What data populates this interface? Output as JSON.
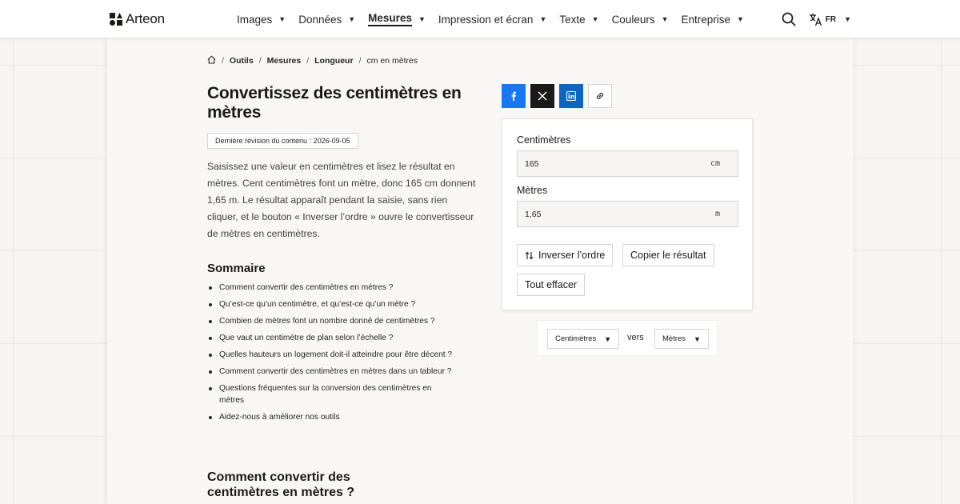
{
  "brand": {
    "name": "Arteon"
  },
  "nav": {
    "items": [
      {
        "label": "Images"
      },
      {
        "label": "Données"
      },
      {
        "label": "Mesures"
      },
      {
        "label": "Impression et écran"
      },
      {
        "label": "Texte"
      },
      {
        "label": "Couleurs"
      },
      {
        "label": "Entreprise"
      }
    ],
    "active_index": 2,
    "caret": "▼",
    "language": "FR"
  },
  "breadcrumb": {
    "separator": "/",
    "items": [
      "Outils",
      "Mesures",
      "Longueur"
    ],
    "current": "cm en mètres"
  },
  "page": {
    "title": "Convertissez des centimètres en mètres",
    "revision": "Dernière révision du contenu : 2026-09-05",
    "intro": "Saisissez une valeur en centimètres et lisez le résultat en mètres. Cent centimètres font un mètre, donc 165 cm donnent 1,65 m. Le résultat apparaît pendant la saisie, sans rien cliquer, et le bouton « Inverser l’ordre » ouvre le convertisseur de mètres en centimètres."
  },
  "toc": {
    "title": "Sommaire",
    "items": [
      "Comment convertir des centimètres en mètres ?",
      "Qu’est-ce qu’un centimètre, et qu’est-ce qu’un mètre ?",
      "Combien de mètres font un nombre donné de centimètres ?",
      "Que vaut un centimètre de plan selon l’échelle ?",
      "Quelles hauteurs un logement doit-il atteindre pour être décent ?",
      "Comment convertir des centimètres en mètres dans un tableur ?",
      "Questions fréquentes sur la conversion des centimètres en mètres",
      "Aidez-nous à améliorer nos outils"
    ]
  },
  "section": {
    "title": "Comment convertir des centimètres en mètres ?"
  },
  "share": {
    "icons": [
      "facebook-icon",
      "x-icon",
      "linkedin-icon",
      "link-icon"
    ],
    "colors": {
      "facebook": "#1877f2",
      "x": "#1c1917",
      "linkedin": "#0a66c2"
    }
  },
  "converter": {
    "input": {
      "label": "Centimètres",
      "value": "165",
      "unit": "cm"
    },
    "output": {
      "label": "Mètres",
      "value": "1,65",
      "unit": "m"
    },
    "swap_label": "Inverser l’ordre",
    "copy_label": "Copier le résultat",
    "clear_label": "Tout effacer"
  },
  "unit_switcher": {
    "from": "Centimètres",
    "connector": "vers",
    "to": "Mètres"
  }
}
